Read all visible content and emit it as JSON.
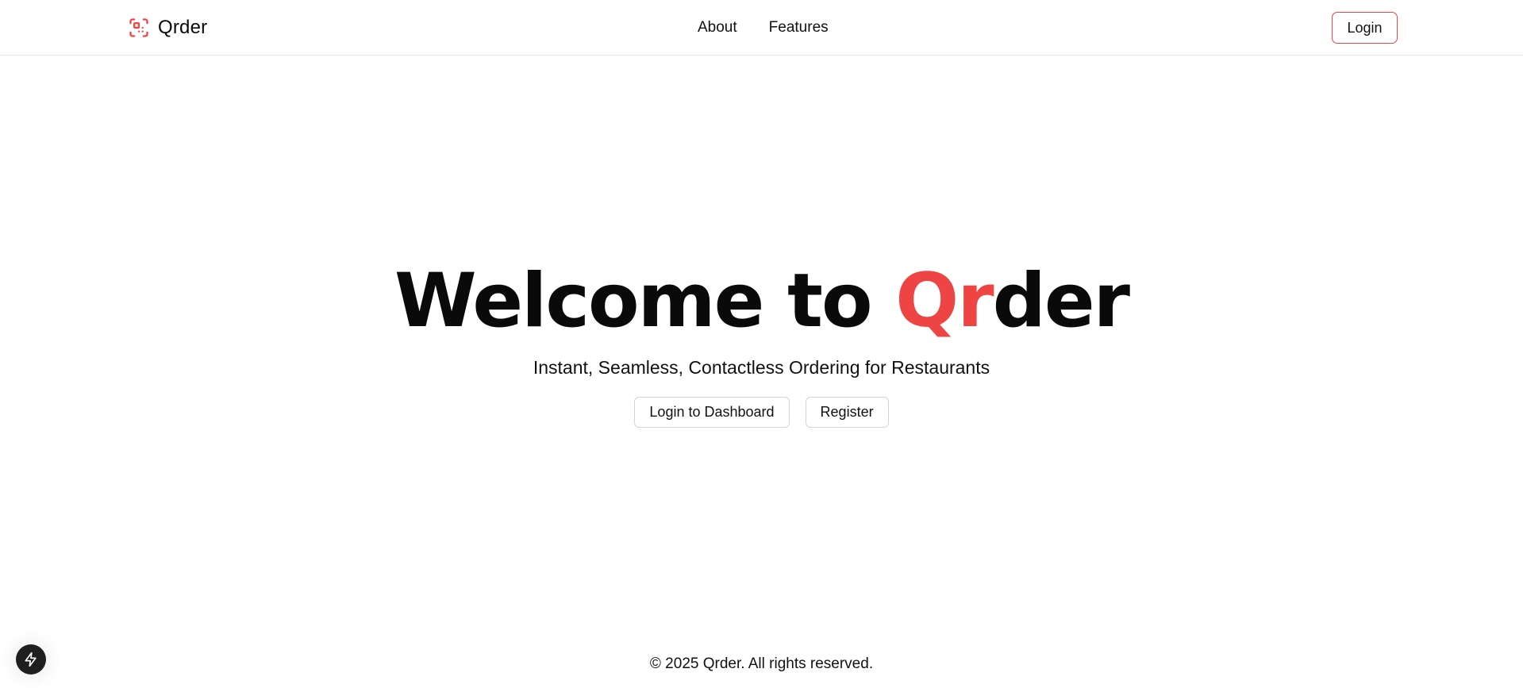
{
  "brand": {
    "name": "Qrder",
    "icon": "qr-scan-icon",
    "accent_color": "#ef4444"
  },
  "nav": {
    "links": [
      "About",
      "Features"
    ],
    "login_label": "Login"
  },
  "hero": {
    "title_prefix": "Welcome to ",
    "title_accent": "Qr",
    "title_suffix": "der",
    "subtitle": "Instant, Seamless, Contactless Ordering for Restaurants",
    "primary_action": "Login to Dashboard",
    "secondary_action": "Register"
  },
  "footer": {
    "copyright": "© 2025 Qrder. All rights reserved."
  },
  "floating_button": {
    "icon": "lightning-icon"
  }
}
